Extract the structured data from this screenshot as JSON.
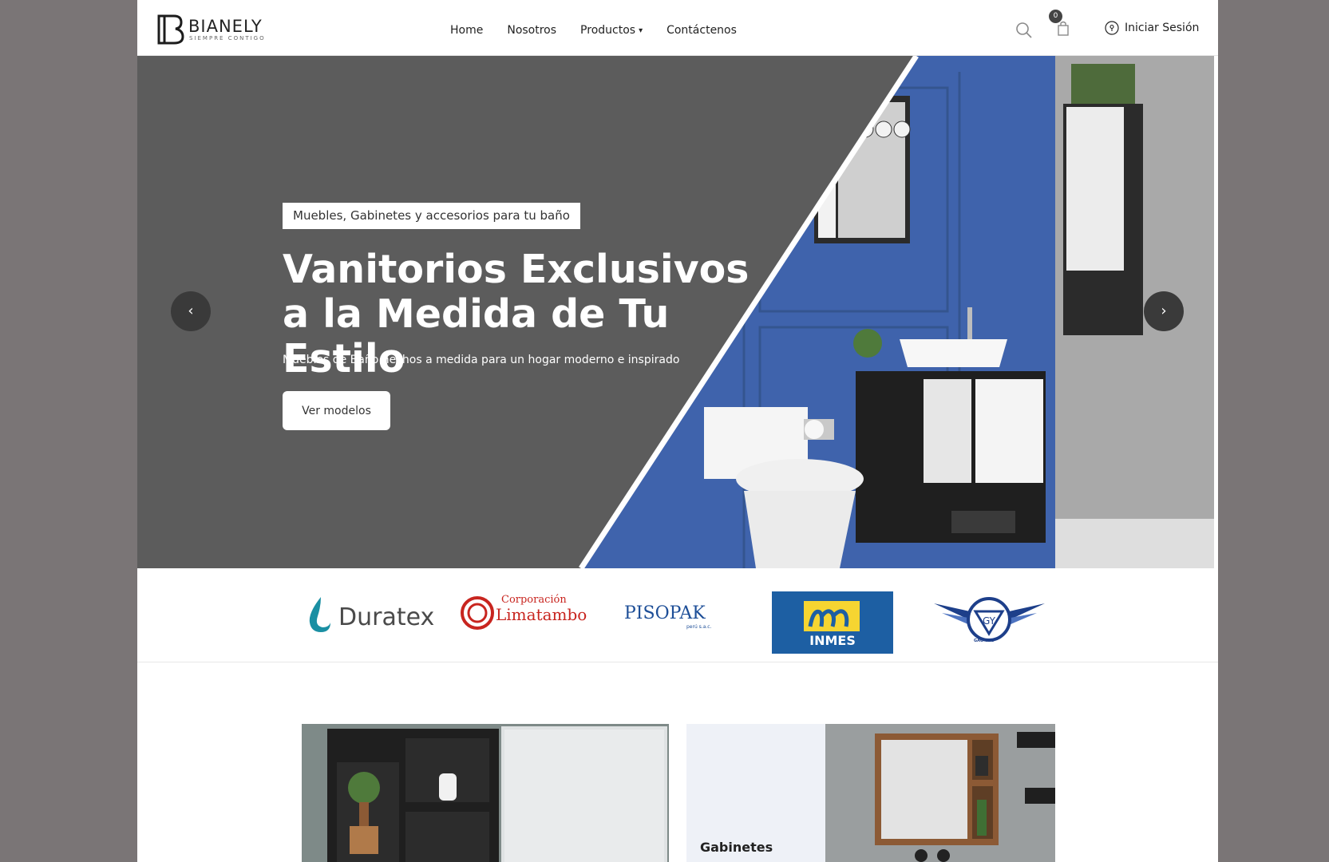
{
  "header": {
    "brand_name": "BIANELY",
    "brand_tagline": "SIEMPRE CONTIGO",
    "nav": [
      {
        "label": "Home"
      },
      {
        "label": "Nosotros"
      },
      {
        "label": "Productos",
        "has_dropdown": true
      },
      {
        "label": "Contáctenos"
      }
    ],
    "cart_count": "0",
    "login_label": "Iniciar Sesión",
    "icons": {
      "search": "search-icon",
      "cart": "shopping-bag-icon",
      "login": "location-pin-icon"
    }
  },
  "hero": {
    "tag": "Muebles, Gabinetes y accesorios para tu baño",
    "title": "Vanitorios Exclusivos a la Medida de Tu Estilo",
    "subtitle": "Muebles de Baño hechos a medida para un hogar moderno e inspirado",
    "cta_label": "Ver modelos",
    "prev_icon": "chevron-left-icon",
    "next_icon": "chevron-right-icon"
  },
  "brands": [
    {
      "name": "Duratex"
    },
    {
      "name": "Corporación",
      "name2": "Limatambo"
    },
    {
      "name": "PISOPAK",
      "sub": "perú s.a.c."
    },
    {
      "name": "INMES"
    },
    {
      "name": "GAO YOU"
    }
  ],
  "categories": [
    {
      "label": ""
    },
    {
      "label": "Gabinetes"
    }
  ],
  "colors": {
    "background": "#7a7576",
    "hero_bg": "#5c5c5c",
    "hero_text": "#ffffff",
    "accent_blue": "#3f63ac",
    "duratex_teal": "#1a8fa3",
    "limatambo_red": "#c8251f",
    "pisopak_blue": "#1d4e97",
    "inmes_blue": "#1d5fa3",
    "inmes_yellow": "#f6d531"
  }
}
